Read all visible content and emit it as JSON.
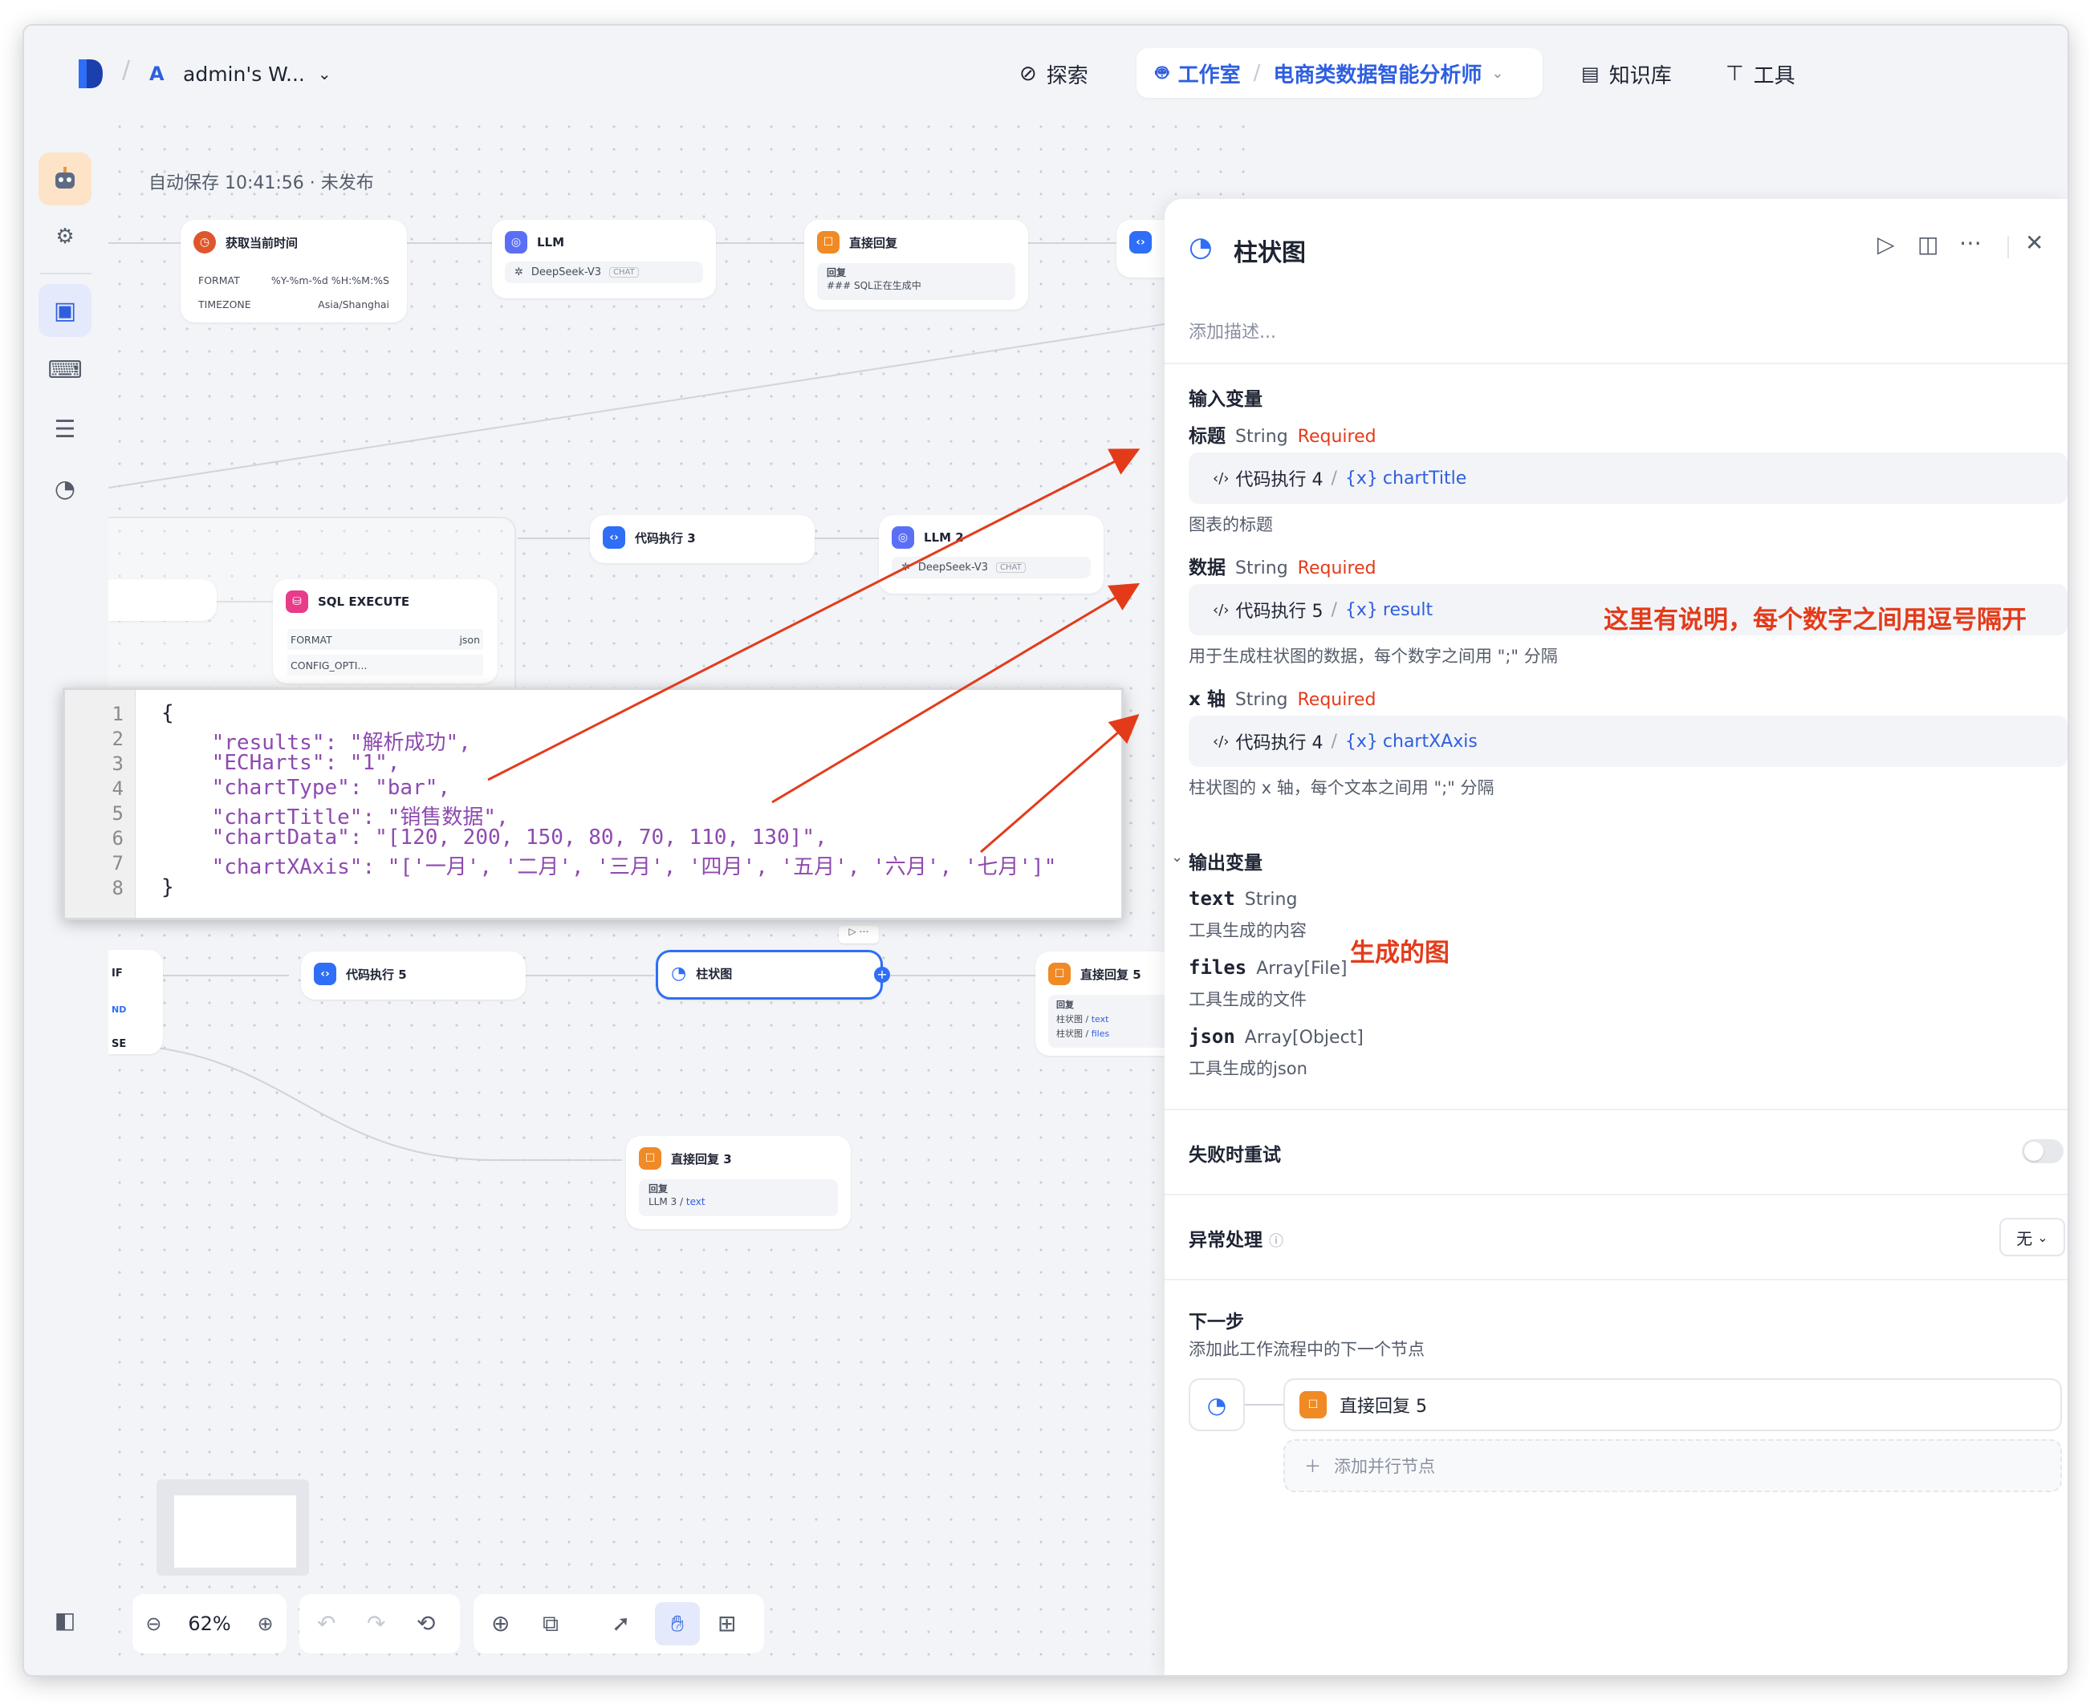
{
  "topbar": {
    "workspace_initial": "A",
    "workspace_name": "admin's W...",
    "nav": {
      "explore": "探索",
      "studio": "工作室",
      "app_name": "电商类数据智能分析师",
      "knowledge": "知识库",
      "tools": "工具"
    }
  },
  "canvas": {
    "autosave": "自动保存 10:41:56 · 未发布",
    "nodes": {
      "time": {
        "title": "获取当前时间",
        "format_label": "FORMAT",
        "format_value": "%Y-%m-%d %H:%M:%S",
        "tz_label": "TIMEZONE",
        "tz_value": "Asia/Shanghai"
      },
      "llm": {
        "title": "LLM",
        "model": "DeepSeek-V3",
        "badge": "CHAT"
      },
      "reply": {
        "title": "直接回复",
        "label": "回复",
        "text": "### SQL正在生成中"
      },
      "code3": {
        "title": "代码执行 3"
      },
      "llm2": {
        "title": "LLM 2",
        "model": "DeepSeek-V3",
        "badge": "CHAT"
      },
      "sql": {
        "title": "SQL EXECUTE",
        "format_label": "FORMAT",
        "format_value": "json",
        "config_label": "CONFIG_OPTI..."
      },
      "code5": {
        "title": "代码执行 5"
      },
      "chart": {
        "title": "柱状图"
      },
      "reply5": {
        "title": "直接回复 5",
        "label": "回复",
        "row1_src": "柱状图",
        "row1_var": "text",
        "row2_src": "柱状图",
        "row2_var": "files"
      },
      "reply3": {
        "title": "直接回复 3",
        "label": "回复",
        "src": "LLM 3",
        "var": "text"
      },
      "if_labels": {
        "if": "IF",
        "and": "ND",
        "else": "SE"
      }
    },
    "code_lines": [
      "{",
      "    \"results\": \"解析成功\",",
      "    \"ECHarts\": \"1\",",
      "    \"chartType\": \"bar\",",
      "    \"chartTitle\": \"销售数据\",",
      "    \"chartData\": \"[120, 200, 150, 80, 70, 110, 130]\",",
      "    \"chartXAxis\": \"['一月', '二月', '三月', '四月', '五月', '六月', '七月']\"",
      "}"
    ],
    "line_numbers": [
      "1",
      "2",
      "3",
      "4",
      "5",
      "6",
      "7",
      "8"
    ],
    "zoom": "62%"
  },
  "panel": {
    "title": "柱状图",
    "desc_placeholder": "添加描述...",
    "input_section": "输入变量",
    "inputs": [
      {
        "name": "标题",
        "type": "String",
        "req": "Required",
        "src": "代码执行 4",
        "var": "chartTitle",
        "desc": "图表的标题"
      },
      {
        "name": "数据",
        "type": "String",
        "req": "Required",
        "src": "代码执行 5",
        "var": "result",
        "desc": "用于生成柱状图的数据，每个数字之间用 \";\" 分隔"
      },
      {
        "name": "x 轴",
        "type": "String",
        "req": "Required",
        "src": "代码执行 4",
        "var": "chartXAxis",
        "desc": "柱状图的 x 轴，每个文本之间用 \";\" 分隔"
      }
    ],
    "output_section": "输出变量",
    "outputs": [
      {
        "name": "text",
        "type": "String",
        "desc": "工具生成的内容"
      },
      {
        "name": "files",
        "type": "Array[File]",
        "desc": "工具生成的文件"
      },
      {
        "name": "json",
        "type": "Array[Object]",
        "desc": "工具生成的json"
      }
    ],
    "retry_label": "失败时重试",
    "error_label": "异常处理",
    "error_value": "无",
    "next_title": "下一步",
    "next_desc": "添加此工作流程中的下一个节点",
    "next_node": "直接回复 5",
    "add_parallel": "添加并行节点"
  },
  "annotations": {
    "note1": "这里有说明，每个数字之间用逗号隔开",
    "note2": "生成的图"
  },
  "colors": {
    "accent": "#2f6ef6",
    "annotation": "#e33b1a",
    "code_string": "#8e4ab0"
  }
}
